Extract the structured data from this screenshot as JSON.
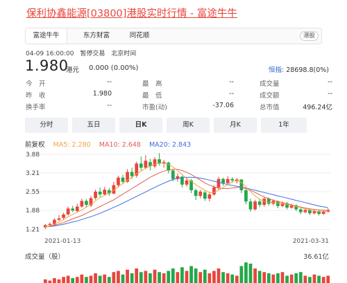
{
  "page": {
    "title": "保利协鑫能源[03800]港股实时行情 - 富途牛牛"
  },
  "tabs": [
    {
      "label": "富途牛牛",
      "active": true
    },
    {
      "label": "东方财富",
      "active": false
    },
    {
      "label": "同花顺",
      "active": false
    }
  ],
  "market_badge": "港股",
  "status": {
    "datetime": "04-09 16:00:00",
    "state": "暂停交易",
    "timezone": "北京时间"
  },
  "quote": {
    "price": "1.980",
    "currency": "港元",
    "change": "0.000 (0.00%)"
  },
  "index": {
    "name": "恒指:",
    "value": "28698.8(0%)"
  },
  "stats": [
    [
      {
        "label": "今　开",
        "value": "--"
      },
      {
        "label": "最　高",
        "value": "--"
      },
      {
        "label": "成交量",
        "value": "--"
      }
    ],
    [
      {
        "label": "昨　收",
        "value": "1.980"
      },
      {
        "label": "最　低",
        "value": "--"
      },
      {
        "label": "成交额",
        "value": "--"
      }
    ],
    [
      {
        "label": "换手率",
        "value": "--"
      },
      {
        "label": "市盈(动)",
        "value": "-37.06"
      },
      {
        "label": "总市值",
        "value": "496.24亿"
      }
    ]
  ],
  "periods": [
    {
      "label": "分时",
      "active": false
    },
    {
      "label": "五日",
      "active": false
    },
    {
      "label": "日K",
      "active": true
    },
    {
      "label": "周K",
      "active": false
    },
    {
      "label": "月K",
      "active": false
    },
    {
      "label": "1年",
      "active": false
    }
  ],
  "legend": {
    "adjust": "前复权",
    "ma5": "MA5: 2.280",
    "ma10": "MA10: 2.648",
    "ma20": "MA20: 2.843"
  },
  "colors": {
    "up": "#e8453c",
    "down": "#22a84a",
    "ma5": "#f2a640",
    "ma10": "#e35d4f",
    "ma20": "#3d6de0",
    "title": "#e8453c",
    "link": "#2a63c9"
  },
  "dates": {
    "start": "2021-01-13",
    "end": "2021-03-31"
  },
  "volume": {
    "label": "成交量（股）",
    "max": "36.61亿"
  },
  "chart_data": [
    {
      "type": "candlestick",
      "title": "",
      "y_ticks": [
        "3.88",
        "3.21",
        "2.55",
        "1.88",
        "1.21"
      ],
      "ylim": [
        1.0,
        4.0
      ],
      "x_labels": [
        "2021-01-13",
        "2021-03-31"
      ],
      "candles": [
        {
          "o": 1.28,
          "c": 1.36,
          "h": 1.4,
          "l": 1.22
        },
        {
          "o": 1.36,
          "c": 1.4,
          "h": 1.46,
          "l": 1.3
        },
        {
          "o": 1.38,
          "c": 1.55,
          "h": 1.6,
          "l": 1.35
        },
        {
          "o": 1.55,
          "c": 1.6,
          "h": 1.72,
          "l": 1.5
        },
        {
          "o": 1.62,
          "c": 1.74,
          "h": 1.8,
          "l": 1.56
        },
        {
          "o": 1.74,
          "c": 1.95,
          "h": 2.02,
          "l": 1.7
        },
        {
          "o": 1.95,
          "c": 1.88,
          "h": 2.05,
          "l": 1.82
        },
        {
          "o": 1.86,
          "c": 2.02,
          "h": 2.12,
          "l": 1.8
        },
        {
          "o": 2.02,
          "c": 2.22,
          "h": 2.3,
          "l": 1.98
        },
        {
          "o": 2.22,
          "c": 2.08,
          "h": 2.28,
          "l": 1.98
        },
        {
          "o": 2.06,
          "c": 2.32,
          "h": 2.4,
          "l": 2.0
        },
        {
          "o": 2.32,
          "c": 2.55,
          "h": 2.62,
          "l": 2.26
        },
        {
          "o": 2.55,
          "c": 2.45,
          "h": 2.7,
          "l": 2.36
        },
        {
          "o": 2.45,
          "c": 2.62,
          "h": 2.72,
          "l": 2.4
        },
        {
          "o": 2.6,
          "c": 2.48,
          "h": 2.68,
          "l": 2.4
        },
        {
          "o": 2.48,
          "c": 2.78,
          "h": 2.9,
          "l": 2.46
        },
        {
          "o": 2.78,
          "c": 3.05,
          "h": 3.12,
          "l": 2.7
        },
        {
          "o": 3.05,
          "c": 2.9,
          "h": 3.15,
          "l": 2.82
        },
        {
          "o": 2.9,
          "c": 3.25,
          "h": 3.35,
          "l": 2.86
        },
        {
          "o": 3.25,
          "c": 3.1,
          "h": 3.4,
          "l": 3.0
        },
        {
          "o": 3.12,
          "c": 3.55,
          "h": 3.62,
          "l": 3.05
        },
        {
          "o": 3.55,
          "c": 3.4,
          "h": 3.8,
          "l": 3.3
        },
        {
          "o": 3.4,
          "c": 3.65,
          "h": 3.85,
          "l": 3.35
        },
        {
          "o": 3.6,
          "c": 3.45,
          "h": 3.72,
          "l": 3.3
        },
        {
          "o": 3.45,
          "c": 3.7,
          "h": 3.78,
          "l": 3.38
        },
        {
          "o": 3.7,
          "c": 3.55,
          "h": 3.92,
          "l": 3.48
        },
        {
          "o": 3.55,
          "c": 3.6,
          "h": 3.68,
          "l": 3.4
        },
        {
          "o": 3.58,
          "c": 3.3,
          "h": 3.62,
          "l": 3.2
        },
        {
          "o": 3.3,
          "c": 3.0,
          "h": 3.35,
          "l": 2.92
        },
        {
          "o": 3.0,
          "c": 3.1,
          "h": 3.2,
          "l": 2.9
        },
        {
          "o": 3.08,
          "c": 2.8,
          "h": 3.12,
          "l": 2.7
        },
        {
          "o": 2.8,
          "c": 2.95,
          "h": 3.05,
          "l": 2.72
        },
        {
          "o": 2.95,
          "c": 2.6,
          "h": 3.0,
          "l": 2.5
        },
        {
          "o": 2.6,
          "c": 2.4,
          "h": 2.66,
          "l": 2.25
        },
        {
          "o": 2.4,
          "c": 2.55,
          "h": 2.62,
          "l": 2.32
        },
        {
          "o": 2.52,
          "c": 2.3,
          "h": 2.58,
          "l": 2.22
        },
        {
          "o": 2.3,
          "c": 2.45,
          "h": 2.52,
          "l": 2.2
        },
        {
          "o": 2.45,
          "c": 2.7,
          "h": 2.78,
          "l": 2.4
        },
        {
          "o": 2.7,
          "c": 3.0,
          "h": 3.08,
          "l": 2.62
        },
        {
          "o": 3.0,
          "c": 2.85,
          "h": 3.05,
          "l": 2.76
        },
        {
          "o": 2.85,
          "c": 3.0,
          "h": 3.1,
          "l": 2.8
        },
        {
          "o": 3.0,
          "c": 2.95,
          "h": 3.06,
          "l": 2.86
        },
        {
          "o": 2.92,
          "c": 2.98,
          "h": 3.04,
          "l": 2.84
        },
        {
          "o": 2.98,
          "c": 2.6,
          "h": 3.0,
          "l": 2.5
        },
        {
          "o": 2.6,
          "c": 2.2,
          "h": 2.64,
          "l": 2.1
        },
        {
          "o": 2.2,
          "c": 1.92,
          "h": 2.3,
          "l": 1.84
        },
        {
          "o": 1.92,
          "c": 2.2,
          "h": 2.26,
          "l": 1.88
        },
        {
          "o": 2.2,
          "c": 2.08,
          "h": 2.28,
          "l": 2.0
        },
        {
          "o": 2.08,
          "c": 2.3,
          "h": 2.36,
          "l": 2.02
        },
        {
          "o": 2.3,
          "c": 2.12,
          "h": 2.34,
          "l": 2.05
        },
        {
          "o": 2.12,
          "c": 2.22,
          "h": 2.28,
          "l": 2.06
        },
        {
          "o": 2.2,
          "c": 2.04,
          "h": 2.24,
          "l": 1.96
        },
        {
          "o": 2.04,
          "c": 2.14,
          "h": 2.2,
          "l": 2.0
        },
        {
          "o": 2.14,
          "c": 1.98,
          "h": 2.18,
          "l": 1.92
        },
        {
          "o": 1.98,
          "c": 2.06,
          "h": 2.12,
          "l": 1.94
        },
        {
          "o": 2.06,
          "c": 1.92,
          "h": 2.1,
          "l": 1.86
        },
        {
          "o": 1.92,
          "c": 1.82,
          "h": 1.96,
          "l": 1.75
        },
        {
          "o": 1.82,
          "c": 1.9,
          "h": 1.95,
          "l": 1.78
        },
        {
          "o": 1.9,
          "c": 1.78,
          "h": 1.94,
          "l": 1.72
        },
        {
          "o": 1.78,
          "c": 1.86,
          "h": 1.92,
          "l": 1.74
        },
        {
          "o": 1.86,
          "c": 1.76,
          "h": 1.9,
          "l": 1.7
        },
        {
          "o": 1.76,
          "c": 1.84,
          "h": 1.9,
          "l": 1.72
        },
        {
          "o": 1.84,
          "c": 1.9,
          "h": 1.96,
          "l": 1.8
        }
      ],
      "ma5": [
        1.3,
        1.33,
        1.4,
        1.47,
        1.55,
        1.66,
        1.74,
        1.82,
        1.9,
        2.0,
        2.1,
        2.22,
        2.34,
        2.42,
        2.5,
        2.6,
        2.72,
        2.84,
        2.96,
        3.06,
        3.18,
        3.28,
        3.38,
        3.46,
        3.52,
        3.56,
        3.56,
        3.52,
        3.42,
        3.3,
        3.16,
        3.02,
        2.92,
        2.8,
        2.7,
        2.6,
        2.52,
        2.52,
        2.6,
        2.7,
        2.8,
        2.9,
        2.95,
        2.88,
        2.72,
        2.55,
        2.4,
        2.28,
        2.2,
        2.18,
        2.16,
        2.14,
        2.12,
        2.1,
        2.06,
        2.02,
        1.98,
        1.94,
        1.9,
        1.86,
        1.84,
        1.84,
        1.86
      ],
      "ma10": [
        1.3,
        1.32,
        1.36,
        1.4,
        1.45,
        1.52,
        1.58,
        1.64,
        1.7,
        1.78,
        1.86,
        1.94,
        2.02,
        2.1,
        2.18,
        2.26,
        2.36,
        2.46,
        2.56,
        2.66,
        2.76,
        2.86,
        2.96,
        3.06,
        3.14,
        3.22,
        3.28,
        3.32,
        3.34,
        3.34,
        3.3,
        3.24,
        3.16,
        3.06,
        2.96,
        2.86,
        2.78,
        2.72,
        2.68,
        2.66,
        2.66,
        2.68,
        2.7,
        2.7,
        2.66,
        2.6,
        2.52,
        2.44,
        2.36,
        2.3,
        2.24,
        2.2,
        2.16,
        2.12,
        2.08,
        2.04,
        2.0,
        1.97,
        1.94,
        1.92,
        1.9,
        1.89,
        1.88
      ],
      "ma20": [
        1.3,
        1.31,
        1.33,
        1.36,
        1.39,
        1.43,
        1.47,
        1.51,
        1.56,
        1.61,
        1.66,
        1.72,
        1.78,
        1.85,
        1.92,
        1.99,
        2.06,
        2.14,
        2.22,
        2.3,
        2.38,
        2.46,
        2.54,
        2.62,
        2.7,
        2.78,
        2.85,
        2.92,
        2.98,
        3.02,
        3.05,
        3.06,
        3.06,
        3.05,
        3.03,
        3.0,
        2.96,
        2.92,
        2.88,
        2.84,
        2.8,
        2.77,
        2.74,
        2.71,
        2.68,
        2.64,
        2.6,
        2.56,
        2.52,
        2.48,
        2.44,
        2.4,
        2.36,
        2.32,
        2.28,
        2.24,
        2.2,
        2.16,
        2.12,
        2.08,
        2.04,
        2.01,
        1.98
      ]
    },
    {
      "type": "bar",
      "title": "成交量（股）",
      "ylim": [
        0,
        100
      ],
      "values": [
        3,
        2,
        4,
        3,
        5,
        6,
        4,
        5,
        7,
        5,
        6,
        8,
        6,
        7,
        5,
        9,
        10,
        7,
        11,
        8,
        12,
        9,
        10,
        8,
        11,
        9,
        8,
        10,
        12,
        9,
        13,
        10,
        14,
        12,
        9,
        11,
        8,
        10,
        12,
        9,
        8,
        7,
        6,
        14,
        17,
        16,
        12,
        10,
        9,
        8,
        7,
        8,
        9,
        6,
        7,
        8,
        9,
        6,
        5,
        7,
        6,
        5,
        6
      ],
      "colors_by_index": "up/down follows candles"
    }
  ]
}
